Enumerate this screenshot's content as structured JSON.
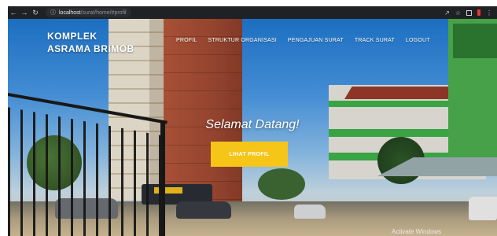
{
  "browser": {
    "back_icon": "arrow-left-icon",
    "forward_icon": "arrow-right-icon",
    "reload_icon": "reload-icon",
    "info_icon": "info-icon",
    "url_host": "localhost",
    "url_path": "/surat/home/#profil",
    "share_icon": "share-icon",
    "star_icon": "star-icon",
    "tab_icon": "tab-icon",
    "extension_icon": "extension-icon",
    "menu_icon": "kebab-menu-icon"
  },
  "site": {
    "brand_line1": "KOMPLEK",
    "brand_line2": "ASRAMA BRIMOB",
    "menu": [
      {
        "label": "PROFIL"
      },
      {
        "label": "STRUKTUR ORGANISASI"
      },
      {
        "label": "PENGAJUAN SURAT"
      },
      {
        "label": "TRACK SURAT"
      },
      {
        "label": "LOGOUT"
      }
    ],
    "welcome": "Selamat Datang!",
    "cta_label": "LIHAT PROFIL"
  },
  "os": {
    "watermark": "Activate Windows"
  },
  "colors": {
    "accent": "#f5c518",
    "browser_bar": "#202124"
  }
}
